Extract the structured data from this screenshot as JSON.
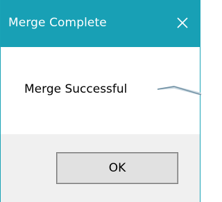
{
  "dialog": {
    "title": "Merge Complete",
    "close_icon": "close-x-icon",
    "message": "Merge Successful",
    "ok_label": "OK"
  },
  "colors": {
    "titlebar": "#18a0b5",
    "footer": "#f0f0f0",
    "button": "#e1e1e1"
  }
}
